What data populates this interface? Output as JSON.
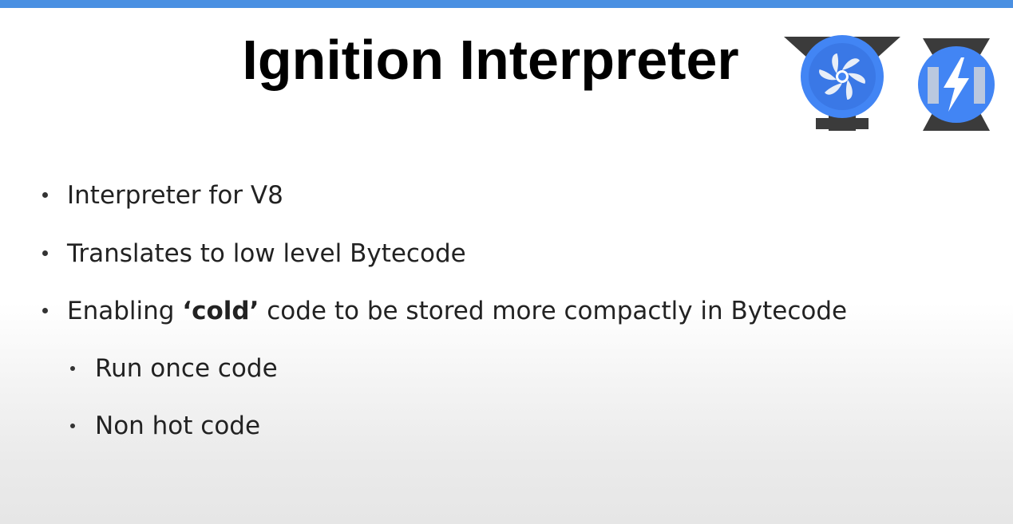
{
  "slide": {
    "title": "Ignition Interpreter",
    "accent_color": "#4a90e2",
    "logos": [
      "ignition-logo-icon",
      "turbofan-bolt-logo-icon"
    ],
    "bullets": [
      {
        "text": "Interpreter for V8"
      },
      {
        "text": "Translates to low level Bytecode"
      },
      {
        "before": "Enabling ",
        "emphasis": "‘cold’",
        "after": " code to be stored more compactly in Bytecode"
      }
    ],
    "sub_bullets": [
      {
        "text": "Run once code"
      },
      {
        "text": "Non hot code"
      }
    ]
  }
}
